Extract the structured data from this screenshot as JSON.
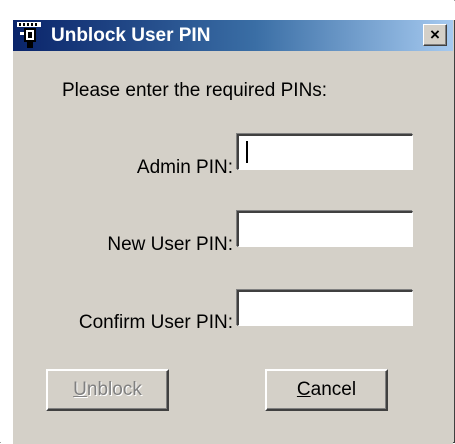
{
  "window": {
    "title": "Unblock User PIN",
    "close_glyph": "×",
    "icon": "smart-card-token-icon"
  },
  "dialog": {
    "prompt": "Please enter the required PINs:",
    "admin_pin_label": "Admin PIN:",
    "admin_pin_value": "",
    "new_user_pin_label": "New User PIN:",
    "new_user_pin_value": "",
    "confirm_user_pin_label": "Confirm User PIN:",
    "confirm_user_pin_value": ""
  },
  "buttons": {
    "unblock_accel": "U",
    "unblock_rest": "nblock",
    "unblock_enabled": false,
    "cancel_accel": "C",
    "cancel_rest": "ancel"
  },
  "colors": {
    "titlebar_start": "#0a246a",
    "titlebar_end": "#a6caf0",
    "face": "#d4d0c8"
  }
}
